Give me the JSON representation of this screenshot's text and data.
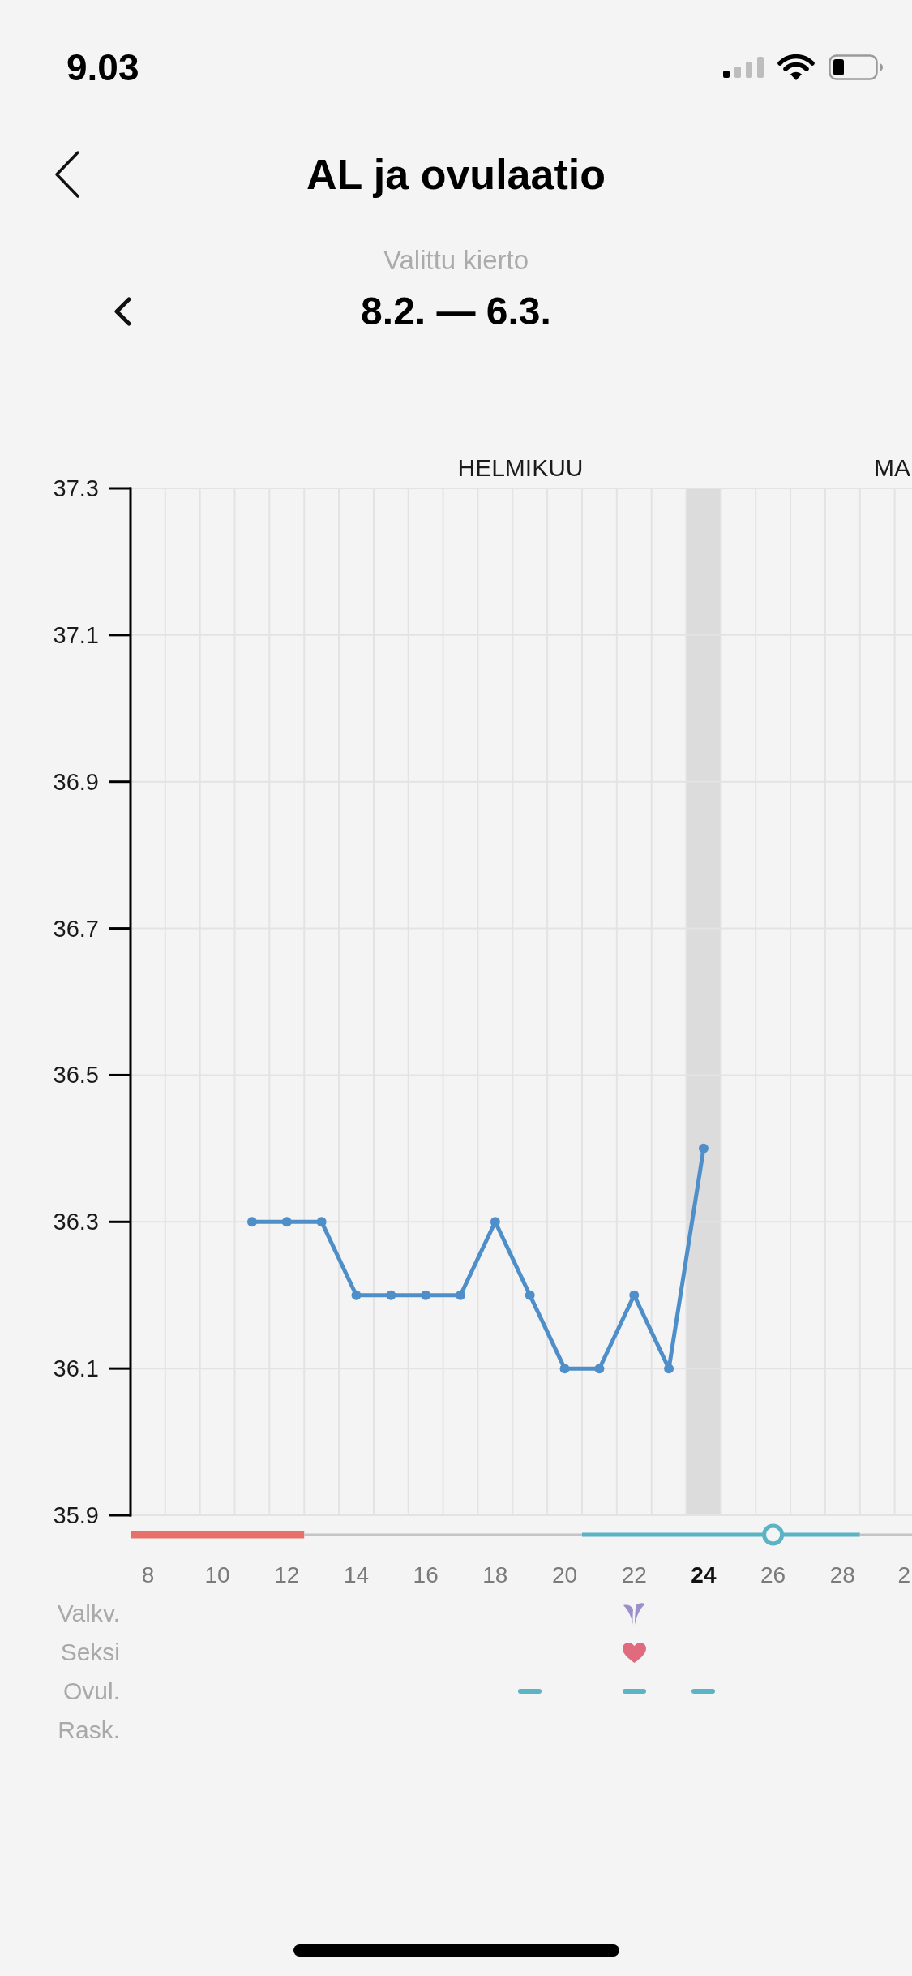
{
  "status_bar": {
    "time": "9.03"
  },
  "header": {
    "title": "AL ja ovulaatio"
  },
  "cycle_selector": {
    "label": "Valittu kierto",
    "range": "8.2. — 6.3."
  },
  "chart": {
    "months": [
      "HELMIKUU",
      "MA"
    ],
    "next_month_ticks": [
      "2"
    ],
    "chart_data": {
      "type": "line",
      "x": [
        11,
        12,
        13,
        14,
        15,
        16,
        17,
        18,
        19,
        20,
        21,
        22,
        23,
        24
      ],
      "series": [
        {
          "color": "#4f8fc9",
          "marker": "circle",
          "values": [
            36.3,
            36.3,
            36.3,
            36.2,
            36.2,
            36.2,
            36.2,
            36.3,
            36.2,
            36.1,
            36.1,
            36.2,
            36.1,
            36.4
          ]
        }
      ],
      "xlim": [
        7.5,
        30
      ],
      "ylim": [
        35.9,
        37.3
      ],
      "xticks": [
        8,
        10,
        12,
        14,
        16,
        18,
        20,
        22,
        24,
        26,
        28
      ],
      "yticks": [
        37.3,
        37.1,
        36.9,
        36.7,
        36.5,
        36.3,
        36.1,
        35.9
      ],
      "grid": true,
      "bands": [
        {
          "axis": "x",
          "from": 23.5,
          "to": 24.5,
          "color": "#dcdcdc"
        }
      ]
    }
  },
  "timeline": [
    {
      "kind": "period"
    },
    {
      "kind": "period"
    },
    {
      "kind": "period"
    },
    {
      "kind": "period"
    },
    {
      "kind": "period"
    },
    {
      "kind": "none"
    },
    {
      "kind": "none"
    },
    {
      "kind": "none"
    },
    {
      "kind": "none"
    },
    {
      "kind": "none"
    },
    {
      "kind": "none"
    },
    {
      "kind": "none"
    },
    {
      "kind": "none"
    },
    {
      "kind": "fertile"
    },
    {
      "kind": "fertile"
    },
    {
      "kind": "fertile"
    },
    {
      "kind": "fertile"
    },
    {
      "kind": "fertile"
    },
    {
      "kind": "ovulation"
    },
    {
      "kind": "fertile"
    },
    {
      "kind": "fertile"
    },
    {
      "kind": "none"
    },
    {
      "kind": "none"
    }
  ],
  "tracking_rows": [
    {
      "label": "Valkv.",
      "cells": [
        {
          "kind": "none"
        },
        {
          "kind": "none"
        },
        {
          "kind": "none"
        },
        {
          "kind": "none"
        },
        {
          "kind": "none"
        },
        {
          "kind": "none"
        },
        {
          "kind": "none"
        },
        {
          "kind": "none"
        },
        {
          "kind": "none"
        },
        {
          "kind": "none"
        },
        {
          "kind": "none"
        },
        {
          "kind": "none"
        },
        {
          "kind": "none"
        },
        {
          "kind": "none"
        },
        {
          "kind": "flower"
        },
        {
          "kind": "none"
        },
        {
          "kind": "none"
        },
        {
          "kind": "none"
        },
        {
          "kind": "none"
        },
        {
          "kind": "none"
        },
        {
          "kind": "none"
        },
        {
          "kind": "none"
        },
        {
          "kind": "none"
        }
      ]
    },
    {
      "label": "Seksi",
      "cells": [
        {
          "kind": "none"
        },
        {
          "kind": "none"
        },
        {
          "kind": "none"
        },
        {
          "kind": "none"
        },
        {
          "kind": "none"
        },
        {
          "kind": "none"
        },
        {
          "kind": "none"
        },
        {
          "kind": "none"
        },
        {
          "kind": "none"
        },
        {
          "kind": "none"
        },
        {
          "kind": "none"
        },
        {
          "kind": "none"
        },
        {
          "kind": "none"
        },
        {
          "kind": "none"
        },
        {
          "kind": "heart"
        },
        {
          "kind": "none"
        },
        {
          "kind": "none"
        },
        {
          "kind": "none"
        },
        {
          "kind": "none"
        },
        {
          "kind": "none"
        },
        {
          "kind": "none"
        },
        {
          "kind": "none"
        },
        {
          "kind": "none"
        }
      ]
    },
    {
      "label": "Ovul.",
      "cells": [
        {
          "kind": "none"
        },
        {
          "kind": "none"
        },
        {
          "kind": "none"
        },
        {
          "kind": "none"
        },
        {
          "kind": "none"
        },
        {
          "kind": "none"
        },
        {
          "kind": "none"
        },
        {
          "kind": "none"
        },
        {
          "kind": "none"
        },
        {
          "kind": "none"
        },
        {
          "kind": "none"
        },
        {
          "kind": "dash"
        },
        {
          "kind": "none"
        },
        {
          "kind": "none"
        },
        {
          "kind": "dash"
        },
        {
          "kind": "none"
        },
        {
          "kind": "dash"
        },
        {
          "kind": "none"
        },
        {
          "kind": "none"
        },
        {
          "kind": "none"
        },
        {
          "kind": "none"
        },
        {
          "kind": "none"
        },
        {
          "kind": "none"
        }
      ]
    },
    {
      "label": "Rask.",
      "cells": [
        {
          "kind": "none"
        },
        {
          "kind": "none"
        },
        {
          "kind": "none"
        },
        {
          "kind": "none"
        },
        {
          "kind": "none"
        },
        {
          "kind": "none"
        },
        {
          "kind": "none"
        },
        {
          "kind": "none"
        },
        {
          "kind": "none"
        },
        {
          "kind": "none"
        },
        {
          "kind": "none"
        },
        {
          "kind": "none"
        },
        {
          "kind": "none"
        },
        {
          "kind": "none"
        },
        {
          "kind": "none"
        },
        {
          "kind": "none"
        },
        {
          "kind": "none"
        },
        {
          "kind": "none"
        },
        {
          "kind": "none"
        },
        {
          "kind": "none"
        },
        {
          "kind": "none"
        },
        {
          "kind": "none"
        },
        {
          "kind": "none"
        }
      ]
    }
  ]
}
